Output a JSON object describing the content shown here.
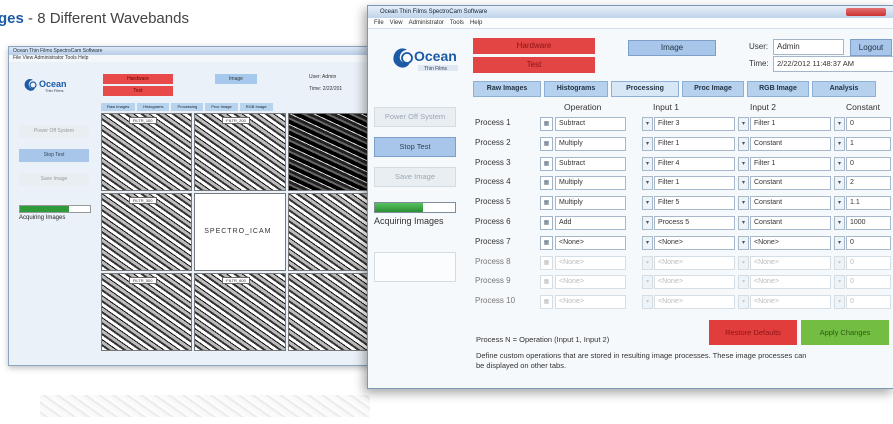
{
  "caption": {
    "prefix": "ges",
    "rest": " - 8 Different Wavebands"
  },
  "background_window": {
    "title": "Ocean Thin Films SpectroCam Software",
    "menu": "File  View  Administrator  Tools  Help",
    "hardware": "Hardware",
    "test": "Test",
    "image": "Image",
    "user": "User: Admin",
    "time": "Time: 2/22/201",
    "tabs": [
      "Raw Images",
      "Histograms",
      "Processing",
      "Proc Image",
      "RGB Image"
    ],
    "side_buttons": [
      "Power Off System",
      "Stop Test",
      "Save Image"
    ],
    "progress": 0.7,
    "acquiring": "Acquiring Images",
    "cell_tags": [
      "FILTR_100",
      "FILTR_200",
      "",
      "FILTR_300",
      "",
      "",
      "FILTR_500",
      "FILTR_600",
      ""
    ],
    "spectrocam": "SPECTRO_ICAM"
  },
  "window": {
    "title": "Ocean Thin Films SpectroCam Software",
    "menu": [
      "File",
      "View",
      "Administrator",
      "Tools",
      "Help"
    ],
    "hardware_label": "Hardware",
    "test_label": "Test",
    "image_label": "Image",
    "user_label": "User:",
    "user_value": "Admin",
    "logout_label": "Logout",
    "time_label": "Time:",
    "time_value": "2/22/2012 11:48:37 AM",
    "tabs": [
      {
        "label": "Raw Images"
      },
      {
        "label": "Histograms"
      },
      {
        "label": "Processing"
      },
      {
        "label": "Proc Image"
      },
      {
        "label": "RGB Image"
      },
      {
        "label": "Analysis"
      }
    ],
    "sidebar": {
      "power_off": "Power Off System",
      "stop_test": "Stop Test",
      "save_image": "Save Image",
      "progress": 0.6,
      "acquiring": "Acquiring Images"
    },
    "headers": {
      "operation": "Operation",
      "input1": "Input 1",
      "input2": "Input 2",
      "constant": "Constant"
    },
    "rows": [
      {
        "name": "Process 1",
        "op": "Subtract",
        "in1": "Filter 3",
        "in2": "Filter 1",
        "const": "0",
        "active": true
      },
      {
        "name": "Process 2",
        "op": "Multiply",
        "in1": "Filter 1",
        "in2": "Constant",
        "const": "1",
        "active": true
      },
      {
        "name": "Process 3",
        "op": "Subtract",
        "in1": "Filter 4",
        "in2": "Filter 1",
        "const": "0",
        "active": true
      },
      {
        "name": "Process 4",
        "op": "Multiply",
        "in1": "Filter 1",
        "in2": "Constant",
        "const": "2",
        "active": true
      },
      {
        "name": "Process 5",
        "op": "Multiply",
        "in1": "Filter 5",
        "in2": "Constant",
        "const": "1.1",
        "active": true
      },
      {
        "name": "Process 6",
        "op": "Add",
        "in1": "Process 5",
        "in2": "Constant",
        "const": "1000",
        "active": true
      },
      {
        "name": "Process 7",
        "op": "<None>",
        "in1": "<None>",
        "in2": "<None>",
        "const": "0",
        "active": true
      },
      {
        "name": "Process 8",
        "op": "<None>",
        "in1": "<None>",
        "in2": "<None>",
        "const": "0",
        "active": false
      },
      {
        "name": "Process 9",
        "op": "<None>",
        "in1": "<None>",
        "in2": "<None>",
        "const": "0",
        "active": false
      },
      {
        "name": "Process 10",
        "op": "<None>",
        "in1": "<None>",
        "in2": "<None>",
        "const": "0",
        "active": false
      }
    ],
    "formula": "Process N = Operation (Input 1, Input 2)",
    "restore_label": "Restore Defaults",
    "apply_label": "Apply Changes",
    "description": "Define custom operations that are stored in resulting image processes. These image processes can be displayed on other tabs."
  },
  "colors": {
    "red": "#e34444",
    "blue": "#a7c6ea",
    "green": "#72bd42",
    "brand": "#1c5aa6"
  }
}
